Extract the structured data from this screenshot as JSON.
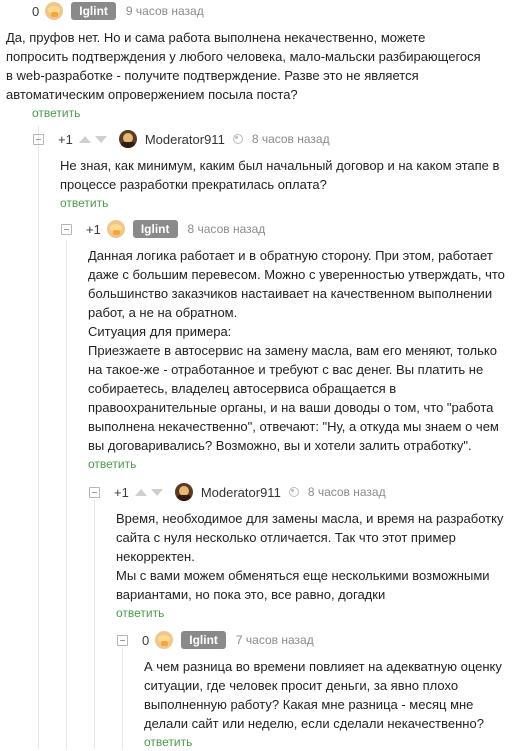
{
  "comments": [
    {
      "rating": "0",
      "author": "Iglint",
      "time": "9 часов назад",
      "text": [
        "Да, пруфов нет. Но и сама работа выполнена некачественно, можете",
        "попросить подтверждения у любого человека, мало-мальски разбирающегося",
        "в web-разработке - получите подтверждение. Разве это не является",
        "автоматическим опровержением посыла поста?"
      ],
      "reply": "ответить"
    },
    {
      "rating": "+1",
      "author": "Moderator911",
      "time": "8 часов назад",
      "text": [
        "Не зная, как минимум, каким был начальный договор и на каком этапе в",
        "процессе разработки прекратилась оплата?"
      ],
      "reply": "ответить"
    },
    {
      "rating": "+1",
      "author": "Iglint",
      "time": "8 часов назад",
      "text": [
        "Данная логика работает и в обратную сторону. При этом, работает",
        "даже с большим перевесом. Можно с уверенностью утверждать, что",
        "большинство заказчиков настаивает на качественном выполнении",
        "работ, а не на обратном.",
        "Ситуация для примера:",
        "Приезжаете в автосервис на замену масла, вам его меняют, только",
        "на такое-же - отработанное и требуют с вас денег. Вы платить не",
        "собираетесь, владелец автосервиса обращается в",
        "правоохранительные органы, и на ваши доводы о том, что \"работа",
        "выполнена некачественно\", отвечают: \"Ну, а откуда мы знаем о чем",
        "вы договаривались? Возможно, вы и хотели залить отработку\"."
      ],
      "reply": "ответить"
    },
    {
      "rating": "+1",
      "author": "Moderator911",
      "time": "8 часов назад",
      "text": [
        "Время, необходимое для замены масла, и время на разработку",
        "сайта с нуля несколько отличается. Так что этот пример",
        "некорректен.",
        "Мы с вами можем обменяться еще несколькими возможными",
        "вариантами, но пока это, все равно, догадки"
      ],
      "reply": "ответить"
    },
    {
      "rating": "0",
      "author": "Iglint",
      "time": "7 часов назад",
      "text": [
        "А чем разница во времени повлияет на адекватную оценку",
        "ситуации, где человек просит деньги, за явно плохо",
        "выполненную работу? Какая мне разница - месяц мне",
        "делали сайт или неделю, если сделали некачественно?"
      ],
      "reply": "ответить"
    }
  ]
}
